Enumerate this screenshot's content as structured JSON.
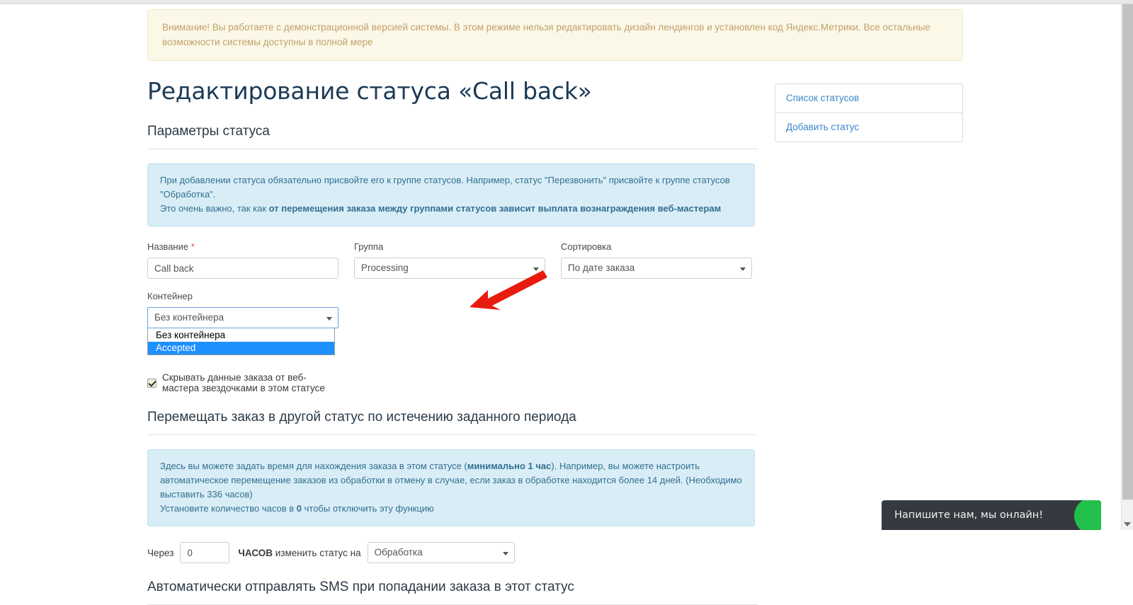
{
  "alerts": {
    "warning": "Внимание! Вы работаете с демонстрационной версией системы. В этом режиме нельзя редактировать дизайн лендингов и установлен код Яндекс.Метрики. Все остальные возможности системы доступны в полной мере",
    "info_status": {
      "line1": "При добавлении статуса обязательно присвойте его к группе статусов. Например, статус \"Перезвонить\" присвойте к группе статусов \"Обработка\".",
      "line2_plain": "Это очень важно, так как ",
      "line2_bold": "от перемещения заказа между группами статусов зависит выплата вознаграждения веб-мастерам"
    },
    "info_period": {
      "part1": "Здесь вы можете задать время для нахождения заказа в этом статусе (",
      "bold1": "минимально 1 час",
      "part2": "). Например, вы можете настроить автоматическое перемещение заказов из обработки в отмену в случае, если заказ в обработке находится более 14 дней. (Необходимо выставить 336 часов)",
      "part3": "Установите количество часов в ",
      "bold2": "0",
      "part4": " чтобы отключить эту функцию"
    }
  },
  "page": {
    "title": "Редактирование статуса «Call back»",
    "section_params": "Параметры статуса",
    "section_move": "Перемещать заказ в другой статус по истечению заданного периода",
    "section_sms": "Автоматически отправлять SMS при попадании заказа в этот статус"
  },
  "form": {
    "name": {
      "label": "Название",
      "required_mark": "*",
      "value": "Call back",
      "placeholder": "Название"
    },
    "group": {
      "label": "Группа",
      "value": "Processing"
    },
    "sorting": {
      "label": "Сортировка",
      "value": "По дате заказа"
    },
    "container": {
      "label": "Контейнер",
      "value": "Без контейнера",
      "options": [
        "Без контейнера",
        "Accepted"
      ],
      "highlighted_option": "Accepted"
    },
    "hide_data_checkbox": {
      "label": "Скрывать данные заказа от веб-мастера звездочками в этом статусе",
      "checked": true
    }
  },
  "period": {
    "label_before": "Через",
    "hours_value": "0",
    "label_mid_bold": "ЧАСОВ",
    "label_mid_rest": " изменить статус на",
    "target_status": "Обработка"
  },
  "sidebar": {
    "items": [
      {
        "label": "Список статусов"
      },
      {
        "label": "Добавить статус"
      }
    ]
  },
  "chat": {
    "message": "Напишите нам, мы онлайн!"
  },
  "colors": {
    "accent_link": "#3b87c9",
    "warning_bg": "#fcf8e8",
    "warning_text": "#c0a16b",
    "info_bg": "#d9edf7",
    "info_text": "#31708f",
    "select_highlight": "#1e90ff",
    "arrow_red": "#e81b0f",
    "chat_bg": "#343a40",
    "chat_blob": "#21c04a",
    "required_red": "#e8453c",
    "title_color": "#1b3a57"
  }
}
